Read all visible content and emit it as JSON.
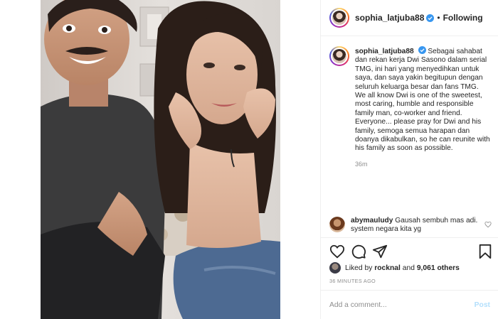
{
  "post": {
    "username": "sophia_latjuba88",
    "follow_state": "Following",
    "separator": "•"
  },
  "caption": {
    "username": "sophia_latjuba88",
    "text": "Sebagai sahabat dan rekan kerja Dwi Sasono dalam serial TMG, ini hari yang menyedihkan untuk saya, dan saya yakin begitupun dengan seluruh keluarga besar dan fans TMG.\nWe all know Dwi is one of the sweetest, most caring, humble and responsible family man, co-worker and friend.\nEveryone... please pray for Dwi and his family, semoga semua harapan dan doanya dikabulkan, so he can reunite with his family as soon as possible.",
    "time": "36m"
  },
  "comment": {
    "username": "abymauludy",
    "text": "Gausah sembuh mas adi. system negara kita yg"
  },
  "likes": {
    "prefix": "Liked by",
    "user": "rocknal",
    "conjunction": "and",
    "count": "9,061 others"
  },
  "timestamp": "36 MINUTES AGO",
  "add_comment": {
    "placeholder": "Add a comment...",
    "post_label": "Post"
  },
  "icons": {
    "like": "heart-icon",
    "comment": "comment-icon",
    "share": "share-icon",
    "save": "bookmark-icon",
    "verified": "verified-badge-icon"
  },
  "colors": {
    "verified": "#3897f0",
    "post_disabled": "#b2dffc",
    "muted": "#8e8e8e"
  }
}
